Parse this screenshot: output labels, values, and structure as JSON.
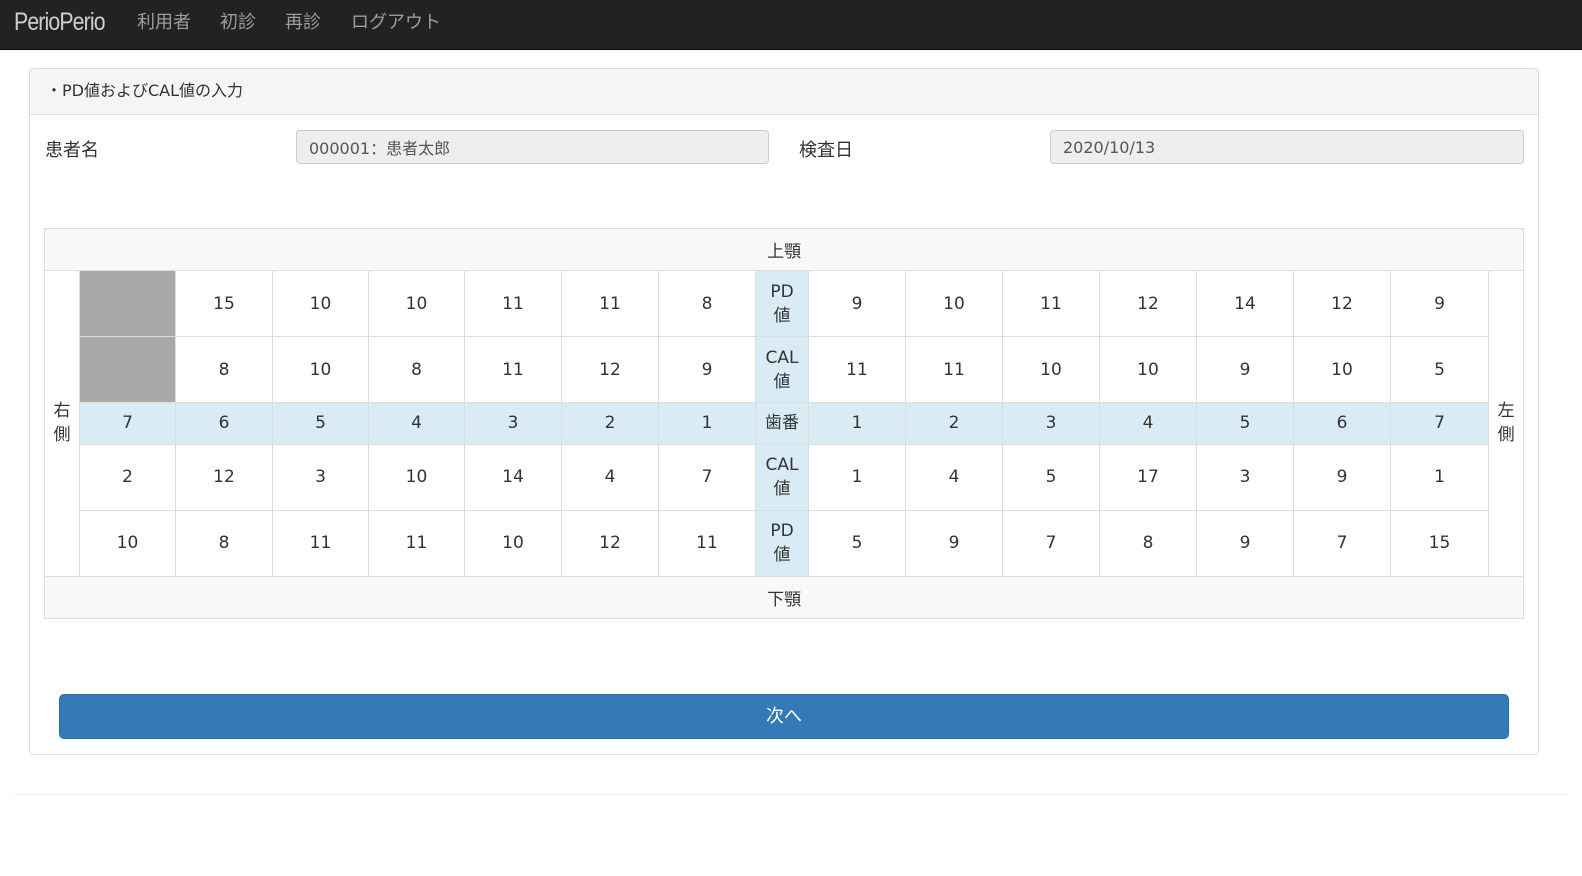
{
  "navbar": {
    "brand": "PerioPerio",
    "items": [
      "利用者",
      "初診",
      "再診",
      "ログアウト"
    ]
  },
  "panel": {
    "title": "・PD値およびCAL値の入力"
  },
  "form": {
    "patient_label": "患者名",
    "patient_value": "000001：患者太郎",
    "date_label": "検査日",
    "date_value": "2020/10/13"
  },
  "chart": {
    "upper_jaw_label": "上顎",
    "lower_jaw_label": "下顎",
    "right_side_label": "右側",
    "left_side_label": "左側",
    "row_labels": {
      "upper_pd": "PD値",
      "upper_cal": "CAL値",
      "tooth_number": "歯番",
      "lower_cal": "CAL値",
      "lower_pd": "PD値"
    },
    "tooth_numbers_right": [
      "7",
      "6",
      "5",
      "4",
      "3",
      "2",
      "1"
    ],
    "tooth_numbers_left": [
      "1",
      "2",
      "3",
      "4",
      "5",
      "6",
      "7"
    ],
    "upper_pd_right": [
      "",
      "15",
      "10",
      "10",
      "11",
      "11",
      "8"
    ],
    "upper_pd_left": [
      "9",
      "10",
      "11",
      "12",
      "14",
      "12",
      "9"
    ],
    "upper_cal_right": [
      "",
      "8",
      "10",
      "8",
      "11",
      "12",
      "9"
    ],
    "upper_cal_left": [
      "11",
      "11",
      "10",
      "10",
      "9",
      "10",
      "5"
    ],
    "lower_cal_right": [
      "2",
      "12",
      "3",
      "10",
      "14",
      "4",
      "7"
    ],
    "lower_cal_left": [
      "1",
      "4",
      "5",
      "17",
      "3",
      "9",
      "1"
    ],
    "lower_pd_right": [
      "10",
      "8",
      "11",
      "11",
      "10",
      "12",
      "11"
    ],
    "lower_pd_left": [
      "5",
      "9",
      "7",
      "8",
      "9",
      "7",
      "15"
    ],
    "missing_teeth_upper_right": [
      "7"
    ],
    "colors": {
      "missing": "#a9a9a9",
      "tooth_row": "#d9ecf5"
    }
  },
  "actions": {
    "next_label": "次へ"
  },
  "colors": {
    "navbar": "#222222",
    "primary": "#337ab7"
  }
}
